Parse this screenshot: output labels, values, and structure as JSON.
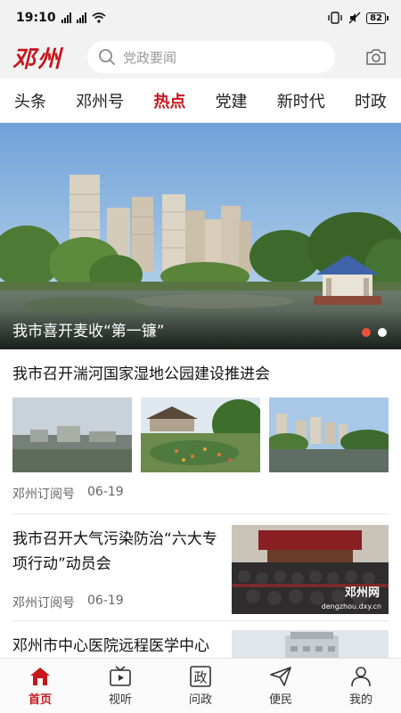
{
  "status_bar": {
    "time": "19:10",
    "signal_1": "4G",
    "signal_2": "4G",
    "battery": "82"
  },
  "header": {
    "logo_text": "邓州",
    "search_placeholder": "党政要闻"
  },
  "tabs": [
    {
      "label": "头条",
      "active": false
    },
    {
      "label": "邓州号",
      "active": false
    },
    {
      "label": "热点",
      "active": true
    },
    {
      "label": "党建",
      "active": false
    },
    {
      "label": "新时代",
      "active": false
    },
    {
      "label": "时政",
      "active": false
    }
  ],
  "banner": {
    "caption": "我市喜开麦收“第一镰”",
    "page_count": 2,
    "active_index": 0
  },
  "news": [
    {
      "title": "我市召开湍河国家湿地公园建设推进会",
      "source": "邓州订阅号",
      "date": "06-19"
    },
    {
      "title": "我市召开大气污染防治“六大专项行动”动员会",
      "source": "邓州订阅号",
      "date": "06-19",
      "image_watermark": "邓州网",
      "image_watermark_sub": "dengzhou.dxy.cn"
    },
    {
      "title": "邓州市中心医院远程医学中心在国家级大赛中获佳绩"
    }
  ],
  "bottom_nav": [
    {
      "label": "首页",
      "icon": "home-icon",
      "active": true
    },
    {
      "label": "视听",
      "icon": "tv-play-icon",
      "active": false
    },
    {
      "label": "问政",
      "icon": "zheng-icon",
      "active": false
    },
    {
      "label": "便民",
      "icon": "send-icon",
      "active": false
    },
    {
      "label": "我的",
      "icon": "user-icon",
      "active": false
    }
  ],
  "colors": {
    "accent": "#c8161d",
    "dot_active": "#e8523c"
  }
}
